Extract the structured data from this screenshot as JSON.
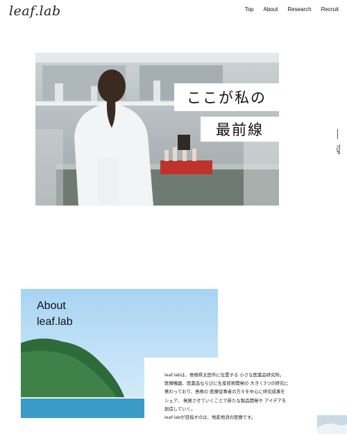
{
  "header": {
    "logo": "leaf.lab",
    "nav": [
      "Top",
      "About",
      "Research",
      "Recruit"
    ]
  },
  "hero": {
    "caption_line1": "ここが私の",
    "caption_line2": "最前線"
  },
  "side": {
    "top_label": "TOP"
  },
  "about": {
    "title_line1": "About",
    "title_line2": "leaf.lab",
    "lines": [
      "leaf.labは、島根県太田市に位置する 小さな医薬品研究所。",
      "医療機器、医薬品ならびに生産技術開発の 大きく3つの研究に",
      "携わっており、島根の 医療従事者の方々を中心に研究成果を",
      "シェア、 発展させていくことで新たな製品開発や アイデアを",
      "創造していく。",
      "leaf.labが目指すのは、地産地消の医療です。"
    ]
  },
  "colors": {
    "accent_red": "#c0322b",
    "sky": "#a8d4f2",
    "sea": "#3a9bc8"
  }
}
